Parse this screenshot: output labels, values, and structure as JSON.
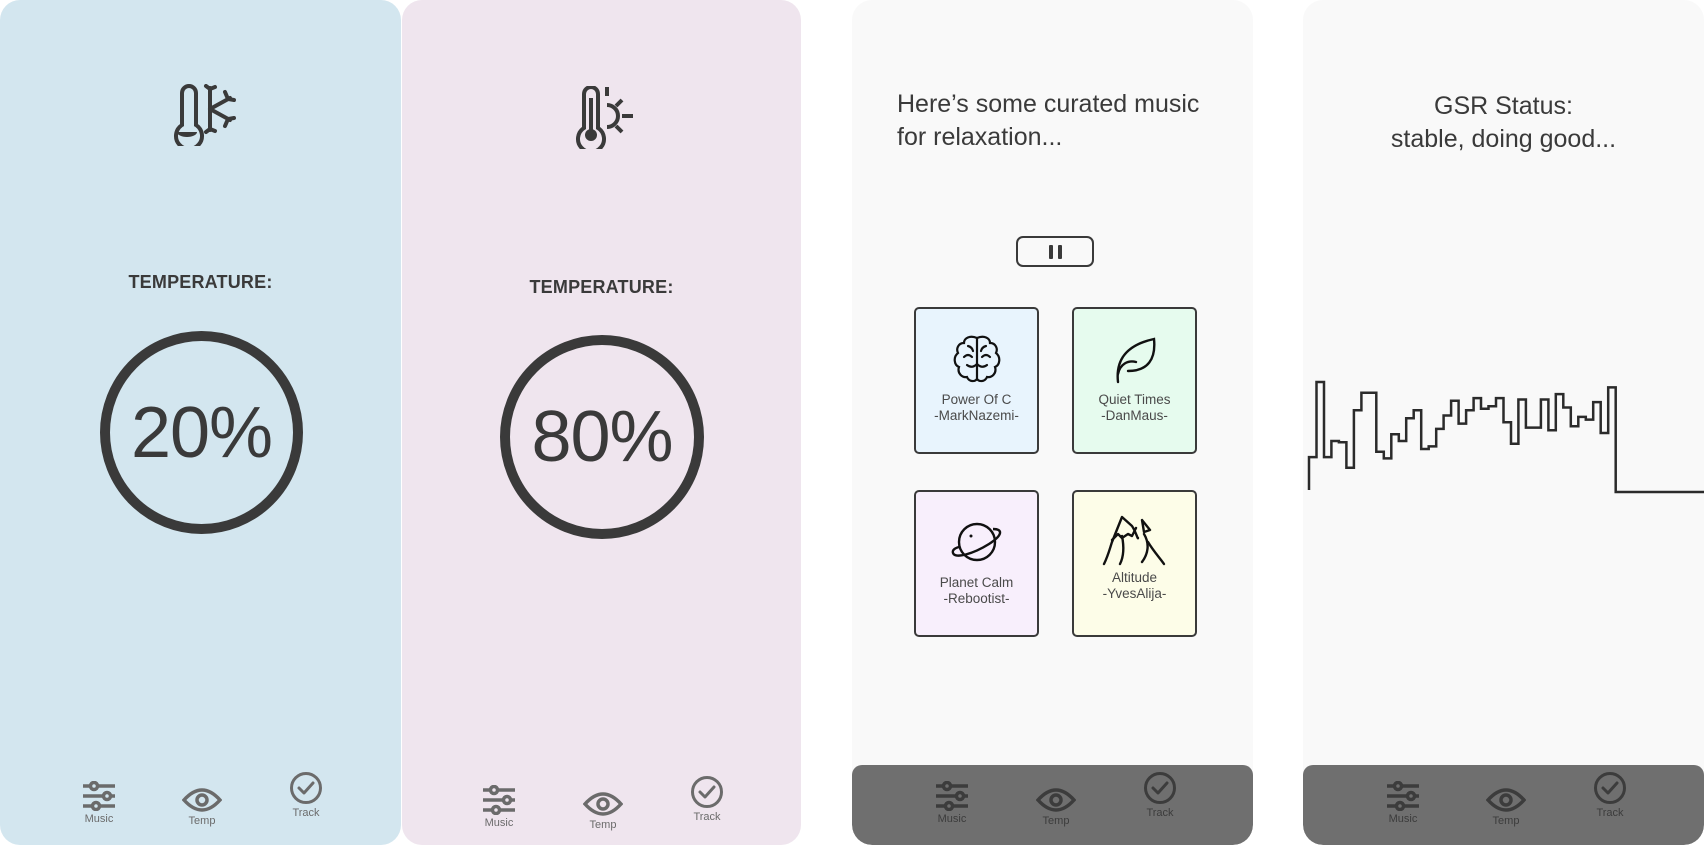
{
  "screens": {
    "cold": {
      "background": "#d3e6ef",
      "icon": "thermometer-snowflake-icon",
      "label": "TEMPERATURE:",
      "value": "20%",
      "percent": 20
    },
    "warm": {
      "background": "#efe5ee",
      "icon": "thermometer-sun-icon",
      "label": "TEMPERATURE:",
      "value": "80%",
      "percent": 80
    },
    "music": {
      "background": "#f9f9f9",
      "headline_line1": "Here’s some curated music",
      "headline_line2": "for relaxation...",
      "pause_icon": "pause-icon",
      "tracks": [
        {
          "title": "Power Of C",
          "artist": "-MarkNazemi-",
          "icon": "brain-icon",
          "color": "#e8f4fd"
        },
        {
          "title": "Quiet Times",
          "artist": "-DanMaus-",
          "icon": "leaf-icon",
          "color": "#e6fbee"
        },
        {
          "title": "Planet Calm",
          "artist": "-Rebootist-",
          "icon": "planet-icon",
          "color": "#f8effc"
        },
        {
          "title": "Altitude",
          "artist": "-YvesAlija-",
          "icon": "mountain-icon",
          "color": "#fdfde8"
        }
      ]
    },
    "gsr": {
      "background": "#f9f9f9",
      "title_line1": "GSR Status:",
      "title_line2": "stable, doing good...",
      "signal_levels": [
        38,
        94,
        38,
        50,
        49,
        30,
        73,
        86,
        86,
        42,
        37,
        55,
        50,
        67,
        73,
        44,
        46,
        59,
        69,
        80,
        63,
        73,
        82,
        74,
        76,
        82,
        64,
        48,
        81,
        60,
        60,
        81,
        58,
        85,
        75,
        61,
        68,
        66,
        79,
        56,
        90
      ]
    }
  },
  "tabbar": {
    "items": [
      {
        "label": "Music",
        "icon": "sliders-icon"
      },
      {
        "label": "Temp",
        "icon": "eye-icon"
      },
      {
        "label": "Track",
        "icon": "check-circle-icon"
      }
    ],
    "dark_color": "#6f6f6f"
  }
}
